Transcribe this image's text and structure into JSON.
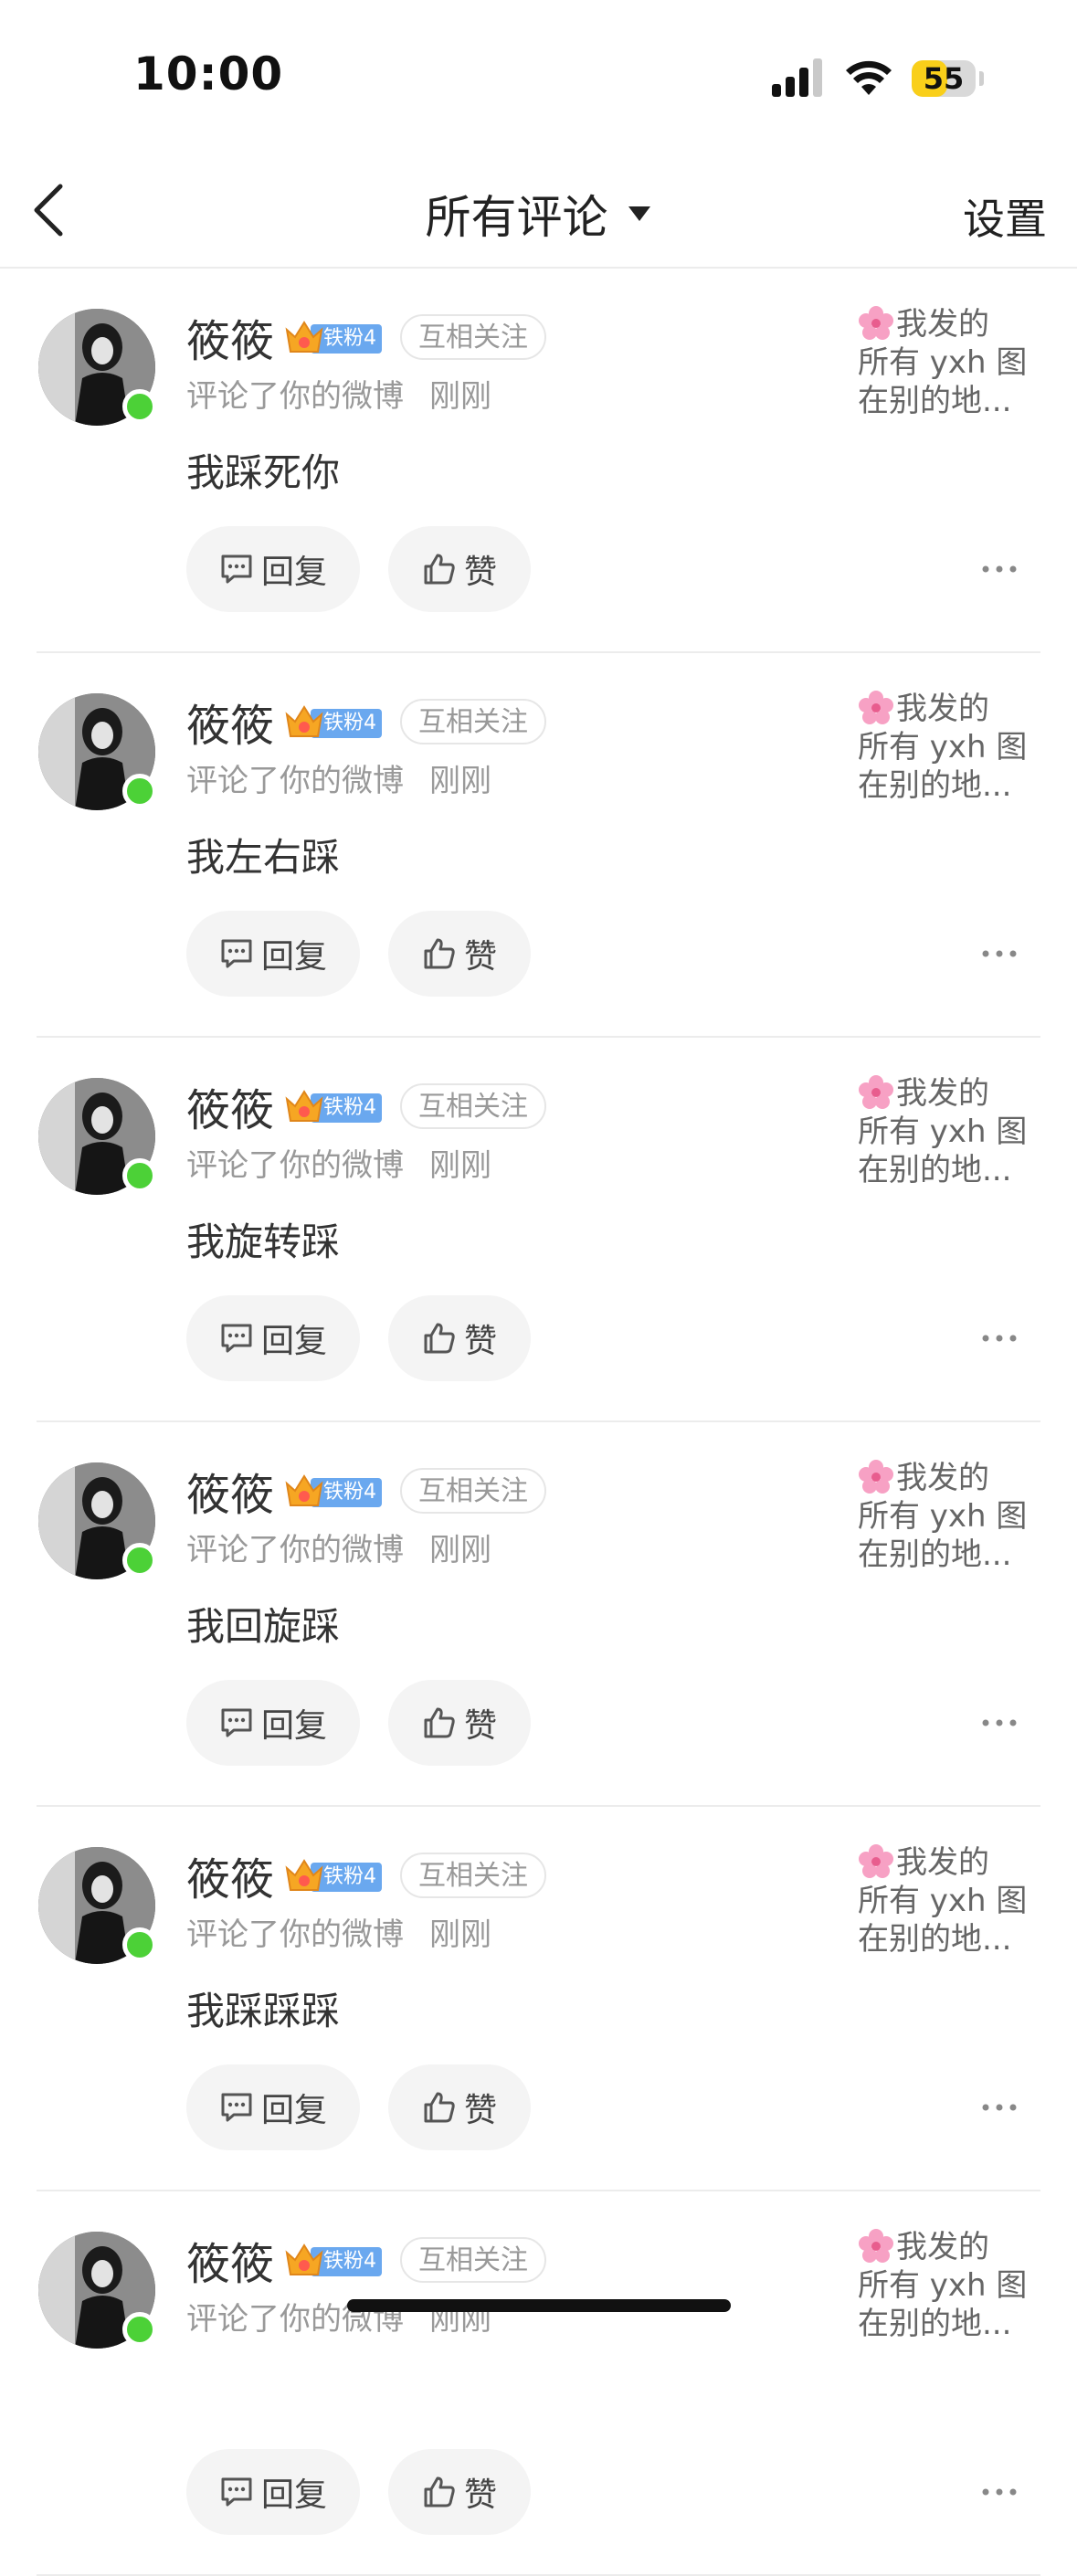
{
  "status_bar": {
    "time": "10:00",
    "battery_level": "55",
    "battery_fraction": 0.55,
    "battery_color": "#f9cf1a"
  },
  "nav": {
    "title": "所有评论",
    "settings": "设置"
  },
  "comments": [
    {
      "user": "筱筱",
      "fan_label": "铁粉4",
      "follow": "互相关注",
      "action": "评论了你的微博",
      "time": "刚刚",
      "text": "我踩死你",
      "reply_label": "回复",
      "like_label": "赞",
      "ref_line1": "我发的",
      "ref_line2": "所有 yxh 图",
      "ref_line3": "在别的地..."
    },
    {
      "user": "筱筱",
      "fan_label": "铁粉4",
      "follow": "互相关注",
      "action": "评论了你的微博",
      "time": "刚刚",
      "text": "我左右踩",
      "reply_label": "回复",
      "like_label": "赞",
      "ref_line1": "我发的",
      "ref_line2": "所有 yxh 图",
      "ref_line3": "在别的地..."
    },
    {
      "user": "筱筱",
      "fan_label": "铁粉4",
      "follow": "互相关注",
      "action": "评论了你的微博",
      "time": "刚刚",
      "text": "我旋转踩",
      "reply_label": "回复",
      "like_label": "赞",
      "ref_line1": "我发的",
      "ref_line2": "所有 yxh 图",
      "ref_line3": "在别的地..."
    },
    {
      "user": "筱筱",
      "fan_label": "铁粉4",
      "follow": "互相关注",
      "action": "评论了你的微博",
      "time": "刚刚",
      "text": "我回旋踩",
      "reply_label": "回复",
      "like_label": "赞",
      "ref_line1": "我发的",
      "ref_line2": "所有 yxh 图",
      "ref_line3": "在别的地..."
    },
    {
      "user": "筱筱",
      "fan_label": "铁粉4",
      "follow": "互相关注",
      "action": "评论了你的微博",
      "time": "刚刚",
      "text": "我踩踩踩",
      "reply_label": "回复",
      "like_label": "赞",
      "ref_line1": "我发的",
      "ref_line2": "所有 yxh 图",
      "ref_line3": "在别的地..."
    },
    {
      "user": "筱筱",
      "fan_label": "铁粉4",
      "follow": "互相关注",
      "action": "评论了你的微博",
      "time": "刚刚",
      "text": "",
      "reply_label": "回复",
      "like_label": "赞",
      "ref_line1": "我发的",
      "ref_line2": "所有 yxh 图",
      "ref_line3": "在别的地..."
    }
  ],
  "colors": {
    "online": "#4cd137",
    "fan_badge": "#6aa8ef",
    "muted_text": "#999999"
  },
  "icons": [
    "signal-icon",
    "wifi-icon",
    "back-icon",
    "caret-down-icon",
    "crown-icon",
    "comment-icon",
    "thumbs-up-icon",
    "more-icon",
    "flower-icon"
  ]
}
